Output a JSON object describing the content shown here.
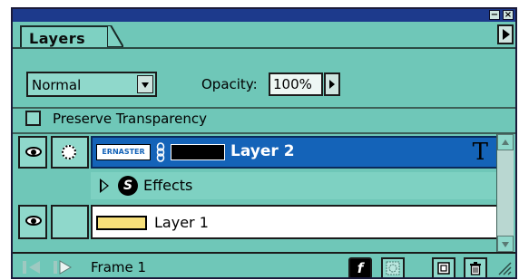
{
  "panel": {
    "tab_label": "Layers",
    "minimize_glyph": "−",
    "close_glyph": "×"
  },
  "blend_mode": {
    "value": "Normal"
  },
  "opacity": {
    "label": "Opacity:",
    "value": "100%"
  },
  "preserve_transparency": {
    "label": "Preserve Transparency",
    "checked": false
  },
  "layers": [
    {
      "name": "Layer 2",
      "thumb_text": "ERNASTER",
      "selected": true,
      "visible": true,
      "type": "text",
      "type_glyph": "T",
      "effects_label": "Effects",
      "effects_badge": "S"
    },
    {
      "name": "Layer 1",
      "selected": false,
      "visible": true,
      "thumb_color": "#f7e07a"
    }
  ],
  "footer": {
    "frame_label": "Frame 1",
    "fx_glyph": "f"
  },
  "colors": {
    "panel_bg": "#6fc7b8",
    "title_bar": "#1d3a8c",
    "selected_row": "#1463b8"
  }
}
